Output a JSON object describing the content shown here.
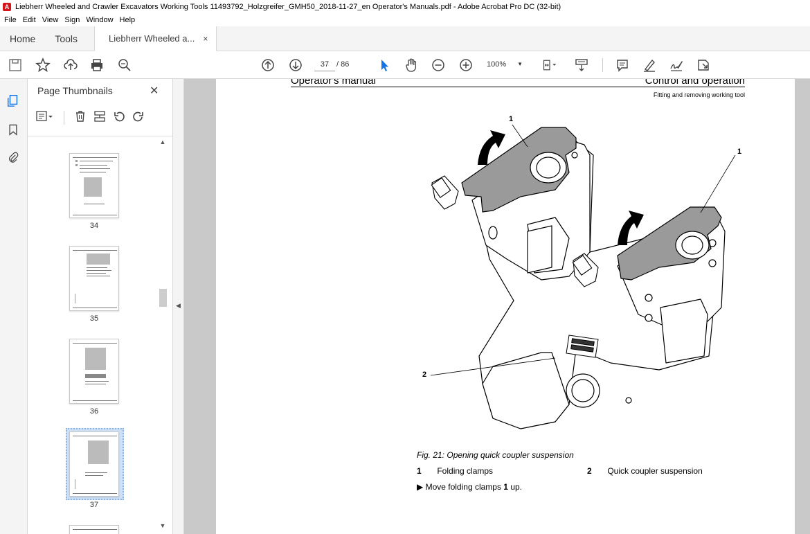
{
  "window": {
    "title": "Liebherr Wheeled and Crawler Excavators  Working Tools  11493792_Holzgreifer_GMH50_2018-11-27_en Operator's Manuals.pdf - Adobe Acrobat Pro DC (32-bit)"
  },
  "menu": [
    "File",
    "Edit",
    "View",
    "Sign",
    "Window",
    "Help"
  ],
  "tabs": {
    "home": "Home",
    "tools": "Tools",
    "document": "Liebherr Wheeled a...",
    "close_glyph": "×"
  },
  "toolbar": {
    "current_page": "37",
    "page_total": "/ 86",
    "zoom": "100%"
  },
  "panel": {
    "title": "Page Thumbnails",
    "close_glyph": "✕",
    "thumbnails": [
      {
        "label": "34"
      },
      {
        "label": "35"
      },
      {
        "label": "36"
      },
      {
        "label": "37",
        "selected": true
      }
    ]
  },
  "page": {
    "header_left": "Operator's manual",
    "header_right": "Control and operation",
    "header_sub": "Fitting and removing working tool",
    "callouts": [
      "1",
      "1",
      "2"
    ],
    "figure_caption": "Fig. 21: Opening quick coupler suspension",
    "legend": [
      {
        "num": "1",
        "text": "Folding clamps"
      },
      {
        "num": "2",
        "text": "Quick coupler suspension"
      }
    ],
    "step_prefix": "Move folding clamps ",
    "step_bold": "1",
    "step_suffix": " up."
  },
  "colors": {
    "accent": "#1473e6",
    "clamp_grey": "#9a9a9a",
    "doc_bg": "#c9c9c9"
  }
}
